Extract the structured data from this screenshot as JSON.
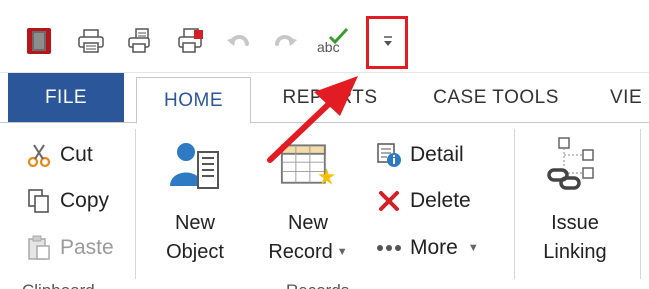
{
  "tabs": {
    "file": "FILE",
    "home": "HOME",
    "reports": "REPORTS",
    "case_tools": "CASE TOOLS",
    "view": "VIE"
  },
  "quick_access_toolbar": {
    "customize_glyph": "⁼",
    "items": [
      "app-logo-icon",
      "print-icon",
      "print-preview-icon",
      "print-all-icon",
      "undo-icon",
      "redo-icon",
      "spellcheck-icon",
      "customize-toolbar-icon"
    ]
  },
  "ribbon": {
    "clipboard": {
      "cut": "Cut",
      "copy": "Copy",
      "paste": "Paste",
      "group_label": "Clipboard"
    },
    "new_object": {
      "line1": "New",
      "line2": "Object"
    },
    "new_record": {
      "line1": "New",
      "line2": "Record"
    },
    "records": {
      "detail": "Detail",
      "delete": "Delete",
      "more": "More",
      "group_label": "Records"
    },
    "issue_linking": {
      "line1": "Issue",
      "line2": "Linking"
    }
  },
  "colors": {
    "file_tab": "#2b579a",
    "highlight": "#e31b23",
    "arrow": "#e31b23"
  }
}
